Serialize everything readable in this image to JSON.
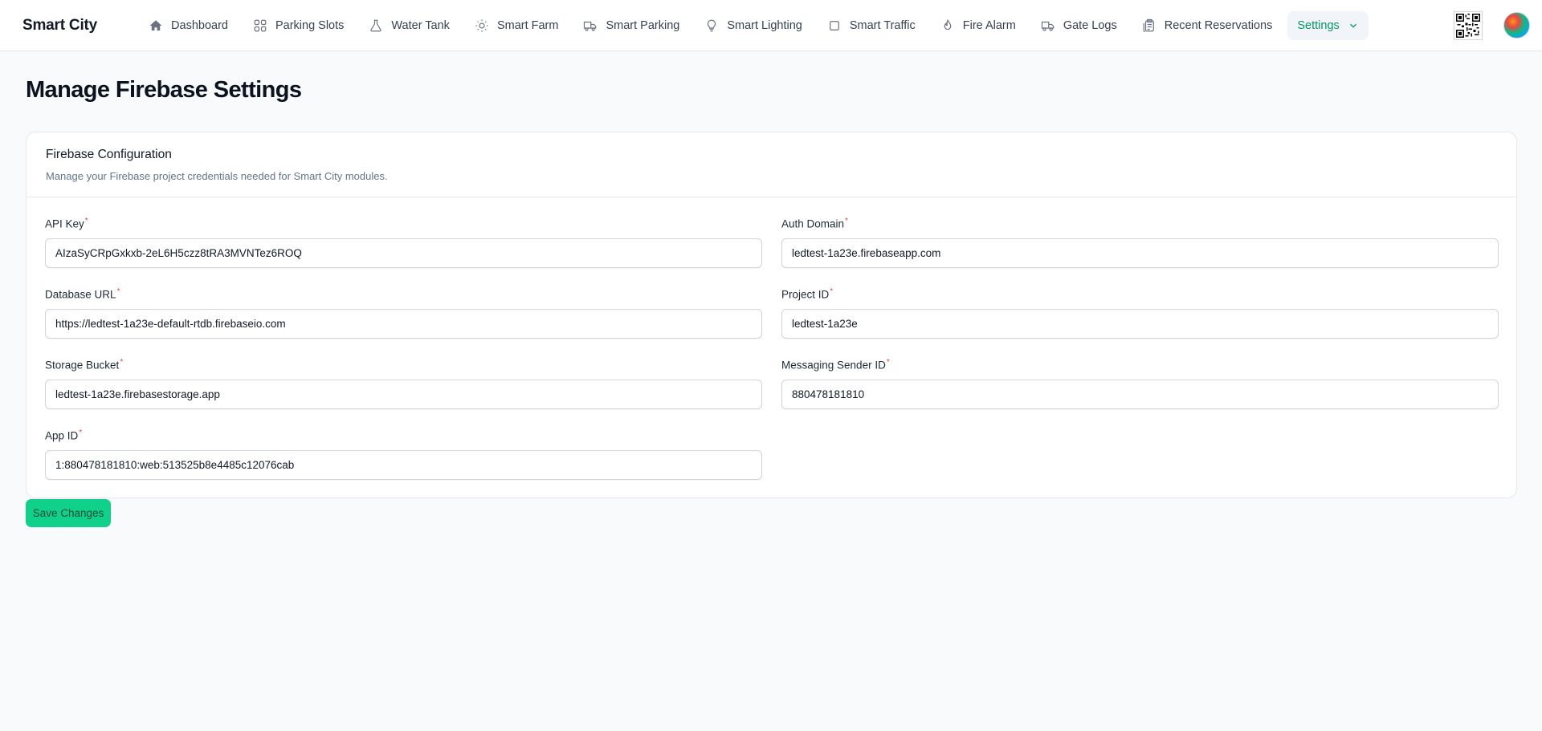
{
  "app": {
    "brand": "Smart City"
  },
  "nav": {
    "items": [
      {
        "label": "Dashboard",
        "icon": "home-icon"
      },
      {
        "label": "Parking Slots",
        "icon": "grid-icon"
      },
      {
        "label": "Water Tank",
        "icon": "flask-icon"
      },
      {
        "label": "Smart Farm",
        "icon": "sun-icon"
      },
      {
        "label": "Smart Parking",
        "icon": "truck-icon"
      },
      {
        "label": "Smart Lighting",
        "icon": "lightbulb-icon"
      },
      {
        "label": "Smart Traffic",
        "icon": "square-icon"
      },
      {
        "label": "Fire Alarm",
        "icon": "flame-icon"
      },
      {
        "label": "Gate Logs",
        "icon": "truck-icon"
      },
      {
        "label": "Recent Reservations",
        "icon": "clipboard-icon"
      }
    ],
    "settings_label": "Settings",
    "accent_color": "#059669"
  },
  "page": {
    "title": "Manage Firebase Settings"
  },
  "card": {
    "title": "Firebase Configuration",
    "subtitle": "Manage your Firebase project credentials needed for Smart City modules."
  },
  "fields": {
    "api_key": {
      "label": "API Key",
      "value": "AIzaSyCRpGxkxb-2eL6H5czz8tRA3MVNTez6ROQ"
    },
    "auth_domain": {
      "label": "Auth Domain",
      "value": "ledtest-1a23e.firebaseapp.com"
    },
    "database_url": {
      "label": "Database URL",
      "value": "https://ledtest-1a23e-default-rtdb.firebaseio.com"
    },
    "project_id": {
      "label": "Project ID",
      "value": "ledtest-1a23e"
    },
    "storage_bucket": {
      "label": "Storage Bucket",
      "value": "ledtest-1a23e.firebasestorage.app"
    },
    "messaging_sender_id": {
      "label": "Messaging Sender ID",
      "value": "880478181810"
    },
    "app_id": {
      "label": "App ID",
      "value": "1:880478181810:web:513525b8e4485c12076cab"
    }
  },
  "required_marker": "*",
  "actions": {
    "save_label": "Save Changes",
    "save_color": "#10d18a"
  }
}
